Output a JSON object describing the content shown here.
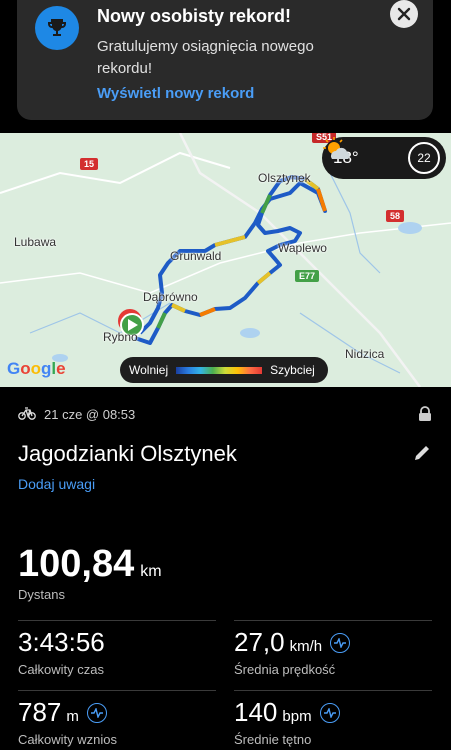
{
  "notification": {
    "title": "Nowy osobisty rekord!",
    "body": "Gratulujemy osiągnięcia nowego rekordu!",
    "action": "Wyświetl nowy rekord",
    "icon": "trophy-icon"
  },
  "map": {
    "places": [
      "Olsztynek",
      "Lubawa",
      "Grunwald",
      "Waplewo",
      "Dąbrówno",
      "Rybno",
      "Nidzica"
    ],
    "roads": [
      "15",
      "S51",
      "58",
      "E77"
    ],
    "weather": {
      "temperature": "18°",
      "icon": "partly-sunny-icon",
      "wind": "22"
    },
    "legend": {
      "slow": "Wolniej",
      "fast": "Szybciej"
    },
    "brand": "Google"
  },
  "activity": {
    "date": "21 cze @ 08:53",
    "name": "Jagodzianki Olsztynek",
    "add_note": "Dodaj uwagi",
    "distance": {
      "value": "100,84",
      "unit": "km",
      "label": "Dystans"
    },
    "total_time": {
      "value": "3:43:56",
      "label": "Całkowity czas"
    },
    "avg_speed": {
      "value": "27,0",
      "unit": "km/h",
      "label": "Średnia prędkość"
    },
    "elevation": {
      "value": "787",
      "unit": "m",
      "label": "Całkowity wznios"
    },
    "avg_hr": {
      "value": "140",
      "unit": "bpm",
      "label": "Średnie tętno"
    }
  }
}
